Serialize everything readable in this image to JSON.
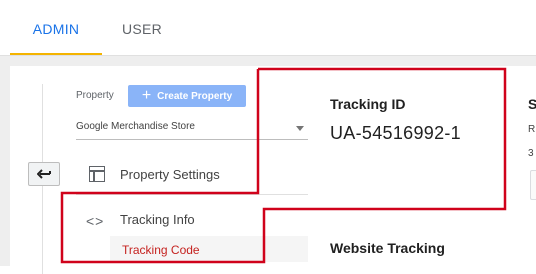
{
  "tabs": {
    "admin": "ADMIN",
    "user": "USER"
  },
  "property": {
    "label": "Property",
    "create_button": "Create Property",
    "selected": "Google Merchandise Store"
  },
  "nav": {
    "property_settings": "Property Settings",
    "tracking_info": "Tracking Info",
    "tracking_code": "Tracking Code"
  },
  "tracking": {
    "title": "Tracking ID",
    "id": "UA-54516992-1",
    "website_tracking_title": "Website Tracking"
  },
  "edge": {
    "s": "S",
    "r": "R",
    "n": "3"
  },
  "colors": {
    "accent": "#1a73e8",
    "tab_underline": "#f4b400",
    "create_button": "#8ab4f8",
    "active_subitem_text": "#c5221f",
    "highlight_outline": "#d0021b"
  },
  "icons": {
    "back": "back-arrow-icon",
    "property_settings": "property-settings-icon",
    "tracking_info": "code-icon",
    "plus": "plus-icon"
  }
}
